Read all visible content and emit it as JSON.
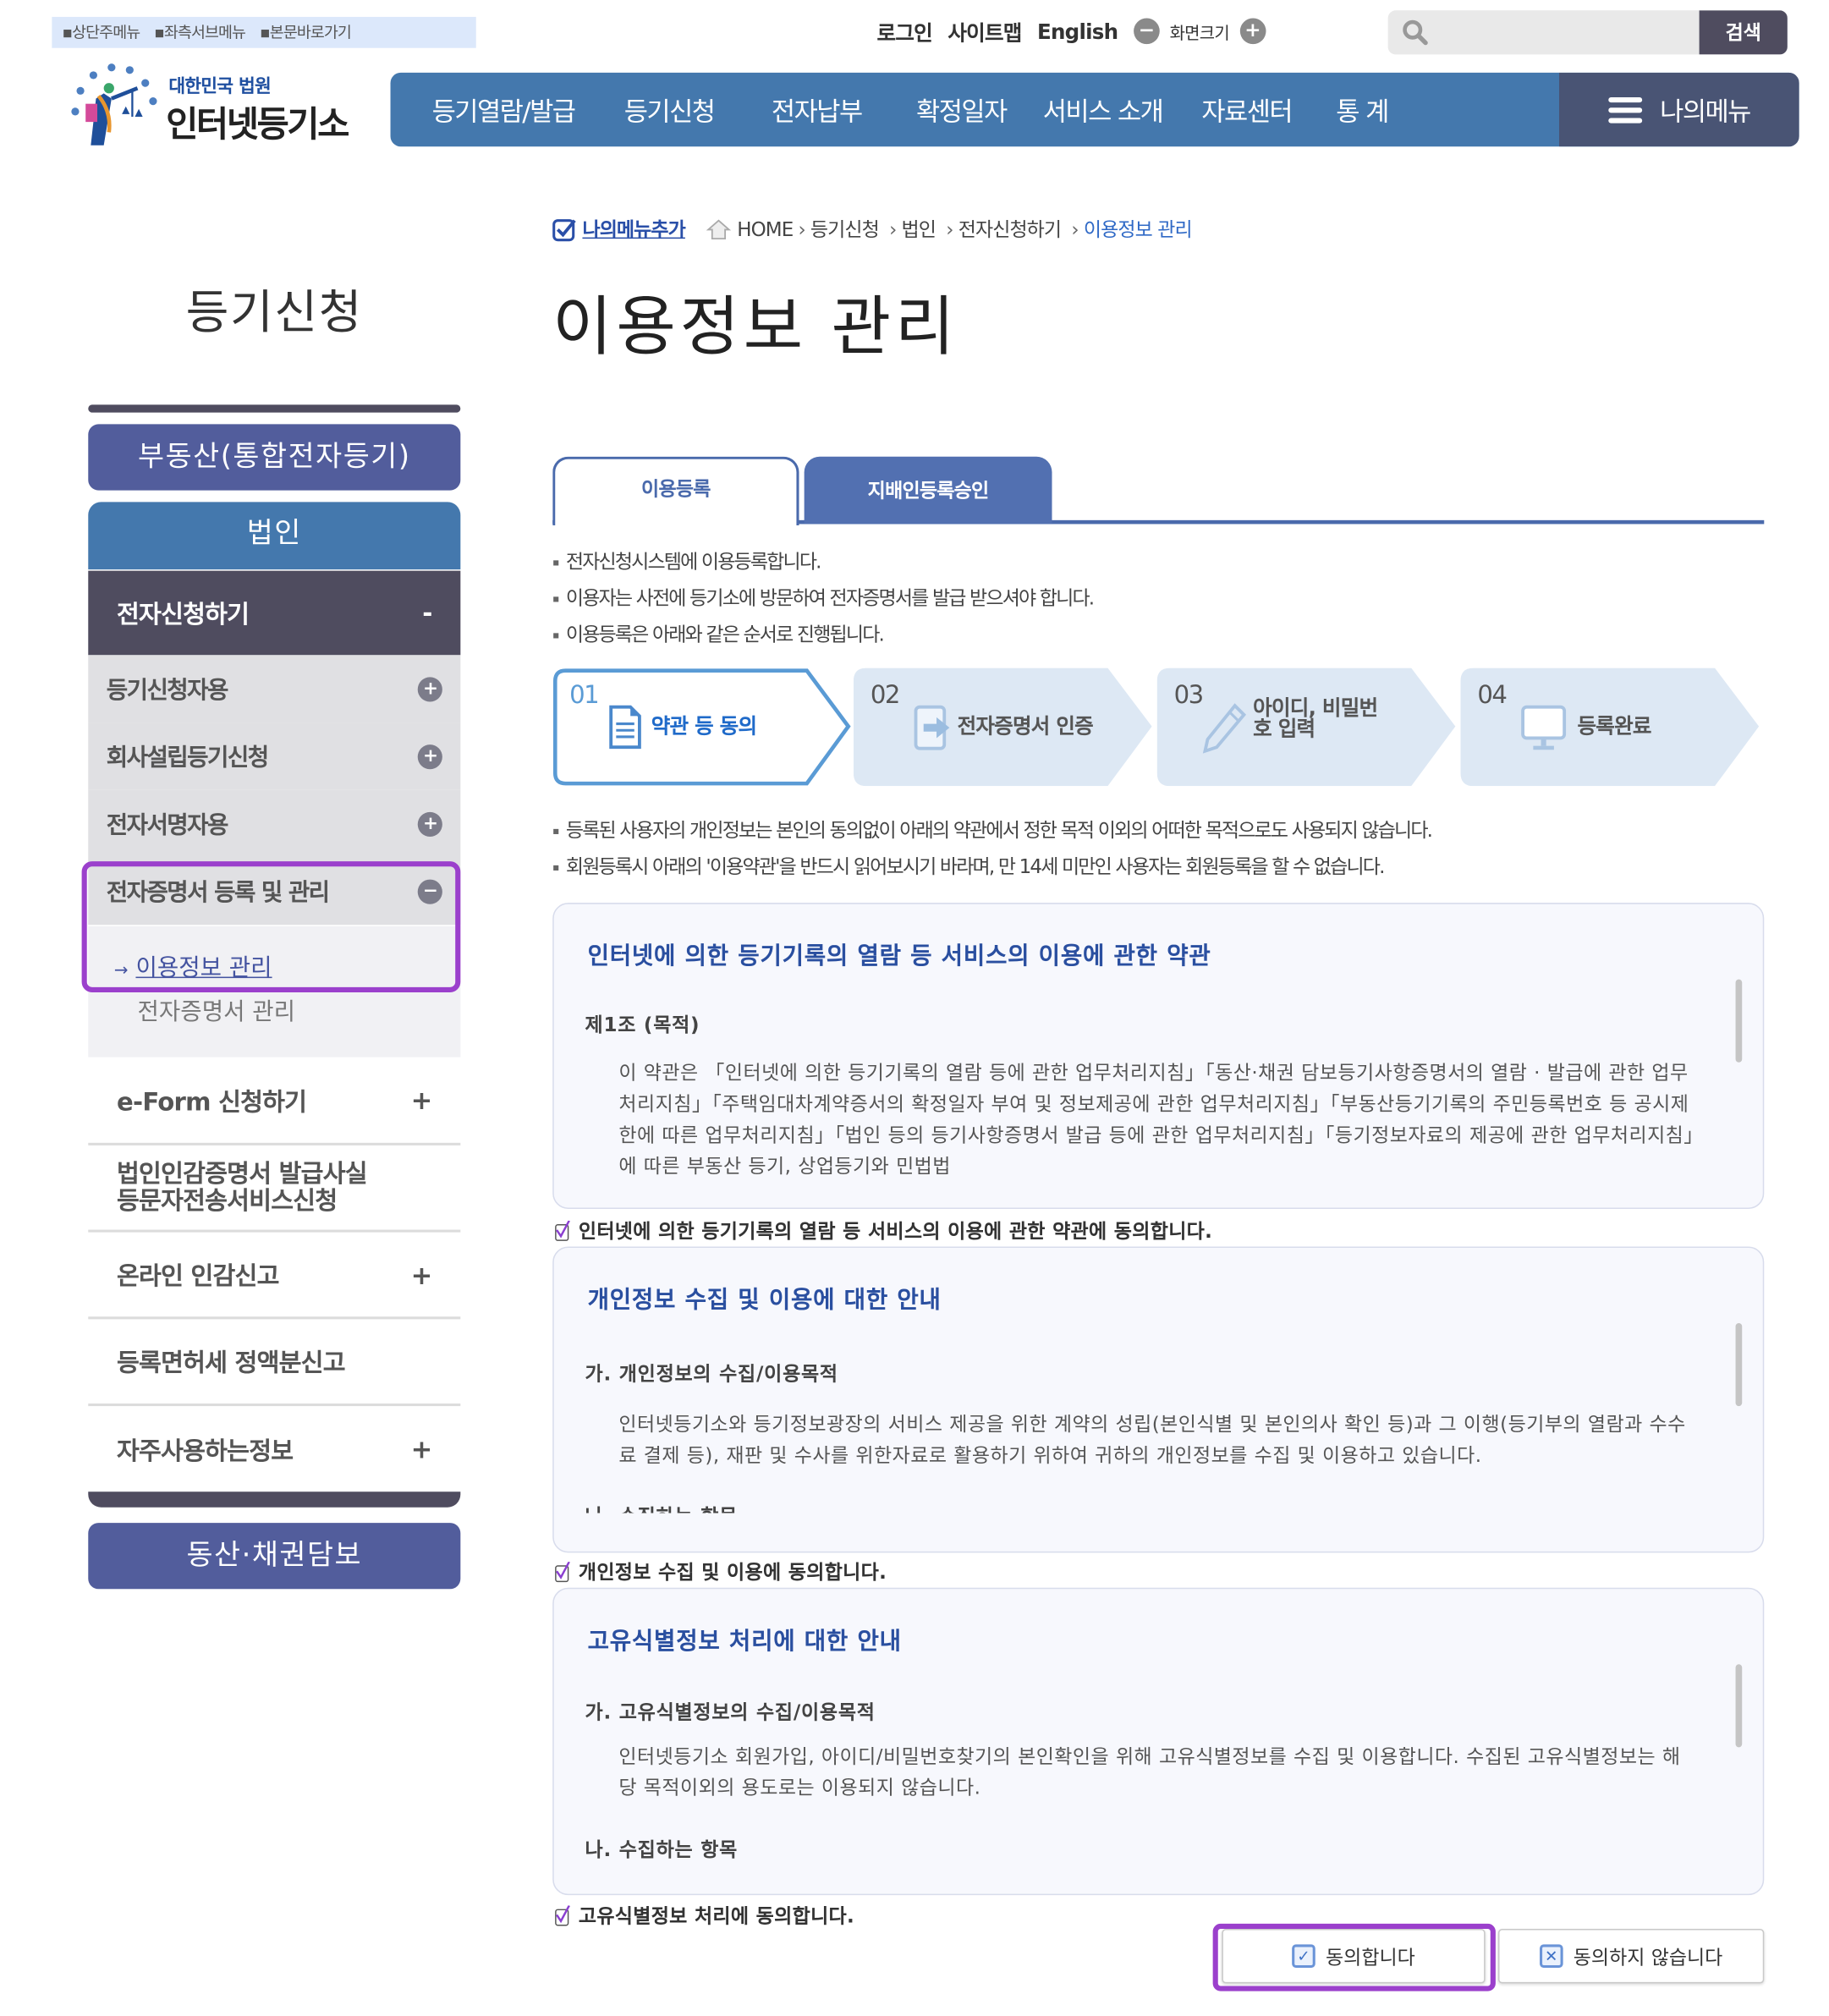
{
  "skip_links": [
    "상단주메뉴",
    "좌측서브메뉴",
    "본문바로가기"
  ],
  "util": {
    "login": "로그인",
    "sitemap": "사이트맵",
    "english": "English",
    "zoom_label": "화면크기",
    "zoom_out_icon": "minus-circle-icon",
    "zoom_in_icon": "plus-circle-icon"
  },
  "search": {
    "placeholder": "",
    "value": "",
    "button": "검색"
  },
  "logo": {
    "sub": "대한민국 법원",
    "main": "인터넷등기소"
  },
  "nav": {
    "items": [
      "등기열람/발급",
      "등기신청",
      "전자납부",
      "확정일자",
      "서비스 소개",
      "자료센터",
      "통 계"
    ],
    "my_menu": "나의메뉴"
  },
  "sidebar": {
    "title": "등기신청",
    "real_estate": "부동산(통합전자등기)",
    "corp": "법인",
    "e_submit": {
      "label": "전자신청하기",
      "toggle": "-"
    },
    "subs": [
      {
        "label": "등기신청자용",
        "toggle": "+"
      },
      {
        "label": "회사설립등기신청",
        "toggle": "+"
      },
      {
        "label": "전자서명자용",
        "toggle": "+"
      },
      {
        "label": "전자증명서 등록 및 관리",
        "toggle": "-"
      }
    ],
    "subsub": [
      {
        "label": "이용정보 관리",
        "active": true,
        "arrow": "→"
      },
      {
        "label": "전자증명서 관리",
        "active": false
      }
    ],
    "items": [
      {
        "label": "e-Form 신청하기",
        "toggle": "+"
      },
      {
        "label": "법인인감증명서 발급사실 등문자전송서비스신청",
        "line1": "법인인감증명서 발급사실",
        "line2": "등문자전송서비스신청",
        "toggle": ""
      },
      {
        "label": "온라인 인감신고",
        "toggle": "+"
      },
      {
        "label": "등록면허세 정액분신고",
        "toggle": ""
      },
      {
        "label": "자주사용하는정보",
        "toggle": "+"
      }
    ],
    "movable": "동산·채권담보"
  },
  "breadcrumb": {
    "add_menu": "나의메뉴추가",
    "items": [
      "HOME",
      "등기신청",
      "법인",
      "전자신청하기",
      "이용정보 관리"
    ]
  },
  "page_title": "이용정보 관리",
  "tabs": [
    {
      "label": "이용등록",
      "active": true
    },
    {
      "label": "지배인등록승인",
      "active": false
    }
  ],
  "intro": [
    "전자신청시스템에 이용등록합니다.",
    "이용자는 사전에 등기소에 방문하여 전자증명서를 발급 받으셔야 합니다.",
    "이용등록은 아래와 같은 순서로 진행됩니다."
  ],
  "steps": [
    {
      "num": "01",
      "label": "약관 등 동의",
      "icon": "document-icon",
      "active": true
    },
    {
      "num": "02",
      "label": "전자증명서 인증",
      "icon": "arrow-in-icon",
      "active": false
    },
    {
      "num": "03",
      "label_line1": "아이디, 비밀번",
      "label_line2": "호 입력",
      "icon": "pencil-icon",
      "active": false
    },
    {
      "num": "04",
      "label": "등록완료",
      "icon": "monitor-icon",
      "active": false
    }
  ],
  "notices": [
    "등록된 사용자의 개인정보는 본인의 동의없이 아래의 약관에서 정한 목적 이외의 어떠한 목적으로도 사용되지 않습니다.",
    "회원등록시 아래의 '이용약관'을 반드시 읽어보시기 바라며, 만 14세 미만인 사용자는 회원등록을 할 수 없습니다."
  ],
  "terms": [
    {
      "title": "인터넷에 의한 등기기록의 열람 등 서비스의 이용에 관한 약관",
      "heading": "제1조 (목적)",
      "body": "이 약관은 「인터넷에 의한 등기기록의 열람 등에 관한 업무처리지침」「동산·채권 담보등기사항증명서의 열람 · 발급에 관한 업무처리지침」「주택임대차계약증서의 확정일자 부여 및 정보제공에 관한 업무처리지침」「부동산등기기록의 주민등록번호 등 공시제한에 따른 업무처리지침」「법인 등의 등기사항증명서 발급 등에 관한 업무처리지침」「등기정보자료의 제공에 관한 업무처리지침」에 따른 부동산 등기, 상업등기와 민법법",
      "agree_label": "인터넷에 의한 등기기록의 열람 등 서비스의 이용에 관한 약관에 동의합니다.",
      "agreed": true
    },
    {
      "title": "개인정보 수집 및 이용에 대한 안내",
      "heading": "가. 개인정보의 수집/이용목적",
      "body": "인터넷등기소와 등기정보광장의 서비스 제공을 위한 계약의 성립(본인식별 및 본인의사 확인 등)과 그 이행(등기부의 열람과 수수료 결제 등), 재판 및 수사를 위한자료로 활용하기 위하여 귀하의 개인정보를 수집 및 이용하고 있습니다.",
      "heading2": "나. 수집하는 항목",
      "agree_label": "개인정보 수집 및 이용에 동의합니다.",
      "agreed": true
    },
    {
      "title": "고유식별정보 처리에 대한 안내",
      "heading": "가. 고유식별정보의 수집/이용목적",
      "body": "인터넷등기소 회원가입, 아이디/비밀번호찾기의 본인확인을 위해 고유식별정보를 수집 및 이용합니다. 수집된 고유식별정보는 해당 목적이외의 용도로는 이용되지 않습니다.",
      "heading2": "나. 수집하는 항목",
      "agree_label": "고유식별정보 처리에 동의합니다.",
      "agreed": true
    }
  ],
  "buttons": {
    "agree": "동의합니다",
    "disagree": "동의하지 않습니다"
  },
  "colors": {
    "nav": "#4478ad",
    "my_menu": "#495474",
    "sidebar_dark": "#4f4c5f",
    "sidebar_purple": "#525d9c",
    "highlight": "#9b40cc",
    "link_blue": "#2a4fa0"
  }
}
